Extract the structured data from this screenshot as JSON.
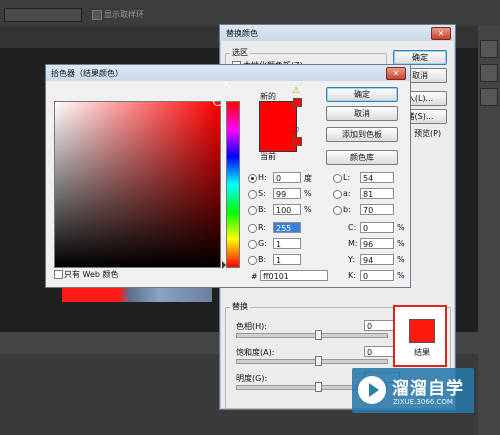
{
  "background": {
    "show_sample_ring": "显示取样环"
  },
  "replace_dialog": {
    "title": "替换颜色",
    "close": "✕",
    "selection_group": "选区",
    "localized_label": "本地化颜色簇(Z)",
    "ok": "确定",
    "cancel": "取消",
    "load": "入(L)...",
    "save": "储(S)...",
    "preview": "预览(P)",
    "replace_group": "替换",
    "hue_label": "色相(H):",
    "hue_value": "0",
    "saturation_label": "饱和度(A):",
    "saturation_value": "0",
    "lightness_label": "明度(G):",
    "lightness_value": "0",
    "result_label": "结果",
    "result_color": "#ff1a10"
  },
  "picker_dialog": {
    "title": "拾色器（结果颜色）",
    "close": "✕",
    "new_label": "新的",
    "current_label": "当前",
    "ok": "确定",
    "cancel": "取消",
    "add_to_swatches": "添加到色板",
    "color_libraries": "颜色库",
    "web_only": "只有 Web 颜色",
    "hex_symbol": "#",
    "hex_value": "ff0101",
    "new_color": "#ff0101",
    "current_color": "#ff0101",
    "fields": {
      "h": {
        "label": "H:",
        "value": "0",
        "unit": "度"
      },
      "s": {
        "label": "S:",
        "value": "99",
        "unit": "%"
      },
      "b": {
        "label": "B:",
        "value": "100",
        "unit": "%"
      },
      "r": {
        "label": "R:",
        "value": "255"
      },
      "g": {
        "label": "G:",
        "value": "1"
      },
      "bl": {
        "label": "B:",
        "value": "1"
      },
      "l": {
        "label": "L:",
        "value": "54"
      },
      "a": {
        "label": "a:",
        "value": "81"
      },
      "lab_b": {
        "label": "b:",
        "value": "70"
      },
      "c": {
        "label": "C:",
        "value": "0",
        "unit": "%"
      },
      "m": {
        "label": "M:",
        "value": "96",
        "unit": "%"
      },
      "y": {
        "label": "Y:",
        "value": "94",
        "unit": "%"
      },
      "k": {
        "label": "K:",
        "value": "0",
        "unit": "%"
      }
    }
  },
  "watermark": {
    "name": "溜溜自学",
    "url": "ZIXUE.3066.COM"
  }
}
